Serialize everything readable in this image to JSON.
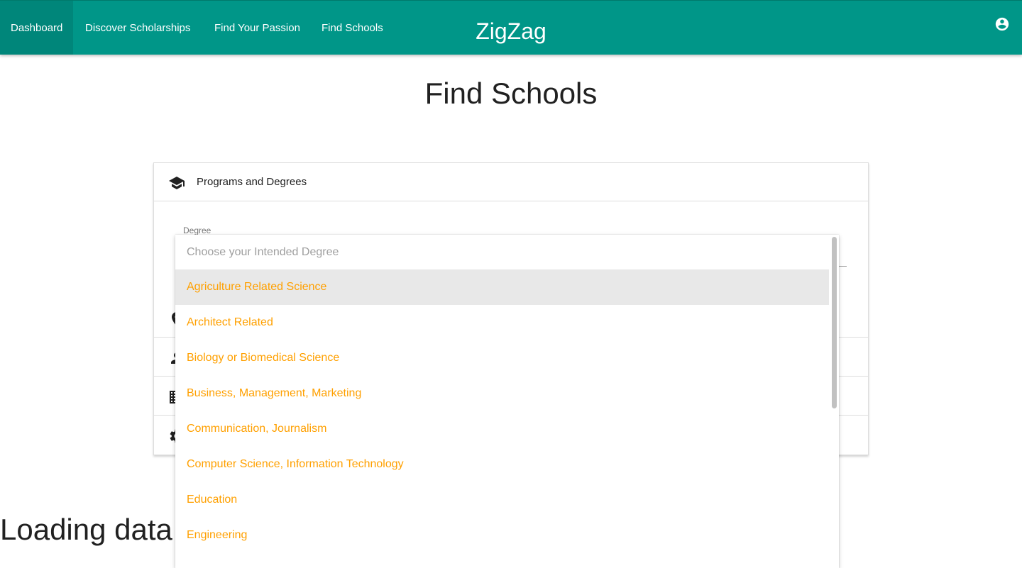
{
  "nav": {
    "items": [
      "Dashboard",
      "Discover Scholarships",
      "Find Your Passion",
      "Find Schools"
    ],
    "active_item": "Dashboard",
    "brand": "ZigZag",
    "account_icon": "account-circle-icon"
  },
  "page": {
    "title": "Find Schools",
    "loading_text": "Loading data"
  },
  "collapsible": {
    "sections": [
      {
        "title": "Programs and Degrees",
        "icon": "graduation-cap-icon",
        "expanded": true
      },
      {
        "title": "",
        "icon": "location-pin-icon"
      },
      {
        "title": "",
        "icon": "person-icon"
      },
      {
        "title": "",
        "icon": "building-icon"
      },
      {
        "title": "",
        "icon": "gear-icon"
      }
    ],
    "degree_label": "Degree"
  },
  "dropdown": {
    "placeholder": "Choose your Intended Degree",
    "options": [
      "Agriculture Related Science",
      "Architect Related",
      "Biology or Biomedical Science",
      "Business, Management, Marketing",
      "Communication, Journalism",
      "Computer Science, Information Technology",
      "Education",
      "Engineering"
    ],
    "highlighted_option": "Agriculture Related Science"
  },
  "colors": {
    "primary": "#009688",
    "option_text": "#ffa000",
    "placeholder_text": "#9e9e9e",
    "highlight_bg": "#e8e8e8"
  }
}
